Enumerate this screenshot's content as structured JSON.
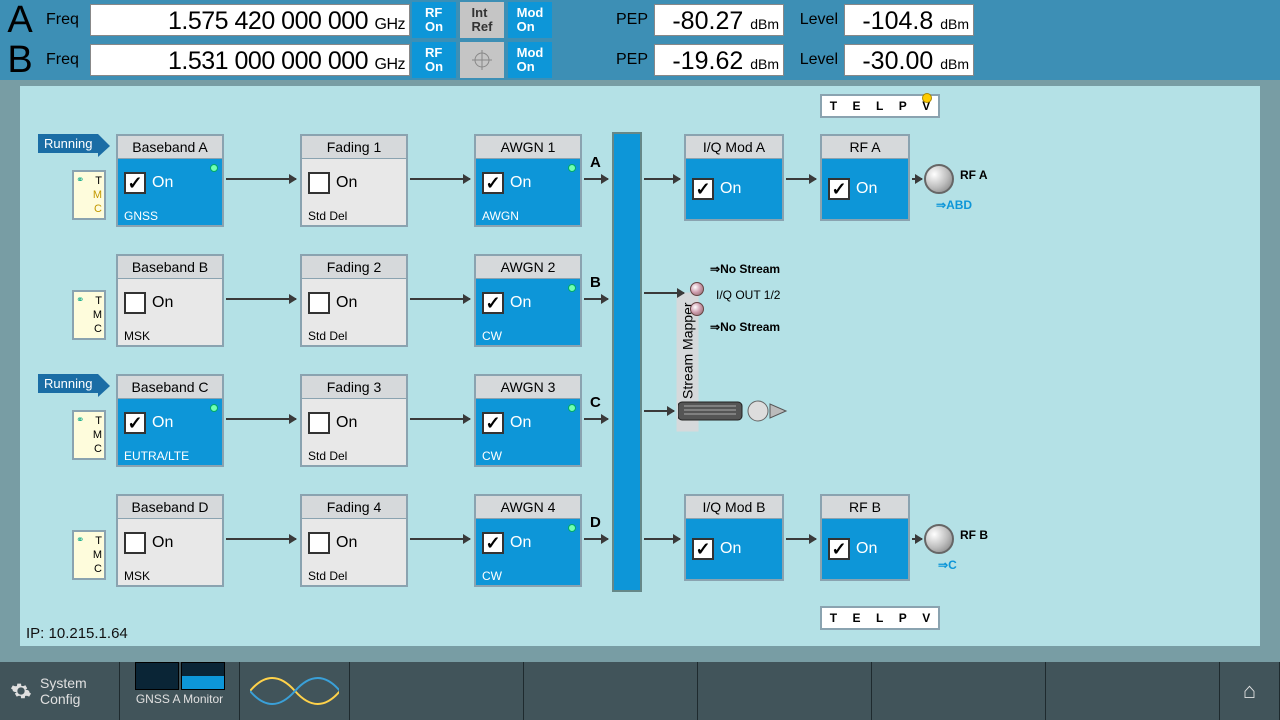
{
  "header": {
    "A": {
      "letter": "A",
      "freq_label": "Freq",
      "freq_value": "1.575 420 000 000",
      "freq_unit": "GHz",
      "rf": "RF\nOn",
      "ref": "Int\nRef",
      "mod": "Mod\nOn",
      "pep_label": "PEP",
      "pep_value": "-80.27",
      "pep_unit": "dBm",
      "lvl_label": "Level",
      "lvl_value": "-104.8",
      "lvl_unit": "dBm"
    },
    "B": {
      "letter": "B",
      "freq_label": "Freq",
      "freq_value": "1.531 000 000 000",
      "freq_unit": "GHz",
      "rf": "RF\nOn",
      "mod": "Mod\nOn",
      "pep_label": "PEP",
      "pep_value": "-19.62",
      "pep_unit": "dBm",
      "lvl_label": "Level",
      "lvl_value": "-30.00",
      "lvl_unit": "dBm"
    }
  },
  "running": "Running",
  "on_label": "On",
  "blocks": {
    "bb": [
      {
        "title": "Baseband A",
        "sub": "GNSS",
        "on": true
      },
      {
        "title": "Baseband B",
        "sub": "MSK",
        "on": false
      },
      {
        "title": "Baseband C",
        "sub": "EUTRA/LTE",
        "on": true
      },
      {
        "title": "Baseband D",
        "sub": "MSK",
        "on": false
      }
    ],
    "fading": [
      {
        "title": "Fading 1",
        "sub": "Std Del",
        "on": false
      },
      {
        "title": "Fading 2",
        "sub": "Std Del",
        "on": false
      },
      {
        "title": "Fading 3",
        "sub": "Std Del",
        "on": false
      },
      {
        "title": "Fading 4",
        "sub": "Std Del",
        "on": false
      }
    ],
    "awgn": [
      {
        "title": "AWGN 1",
        "sub": "AWGN",
        "on": true
      },
      {
        "title": "AWGN 2",
        "sub": "CW",
        "on": true
      },
      {
        "title": "AWGN 3",
        "sub": "CW",
        "on": true
      },
      {
        "title": "AWGN 4",
        "sub": "CW",
        "on": true
      }
    ],
    "iqmod": [
      {
        "title": "I/Q Mod A",
        "on": true
      },
      {
        "title": "I/Q Mod B",
        "on": true
      }
    ],
    "rf": [
      {
        "title": "RF A",
        "on": true
      },
      {
        "title": "RF B",
        "on": true
      }
    ]
  },
  "side_letters": [
    "A",
    "B",
    "C",
    "D"
  ],
  "sidebadge": {
    "t": "T",
    "m": "M",
    "c": "C"
  },
  "mapper_label": "I/Q Stream Mapper",
  "iq_out": {
    "no_stream": "No Stream",
    "iq_out_label": "I/Q OUT 1/2"
  },
  "rf_conn": {
    "a": "RF A",
    "a_sub": "ABD",
    "b": "RF B",
    "b_sub": "C"
  },
  "telpv": [
    "T",
    "E",
    "L",
    "P",
    "V"
  ],
  "ip": "IP: 10.215.1.64",
  "footer": {
    "system_config": "System\nConfig",
    "gnss_monitor": "GNSS A Monitor"
  }
}
